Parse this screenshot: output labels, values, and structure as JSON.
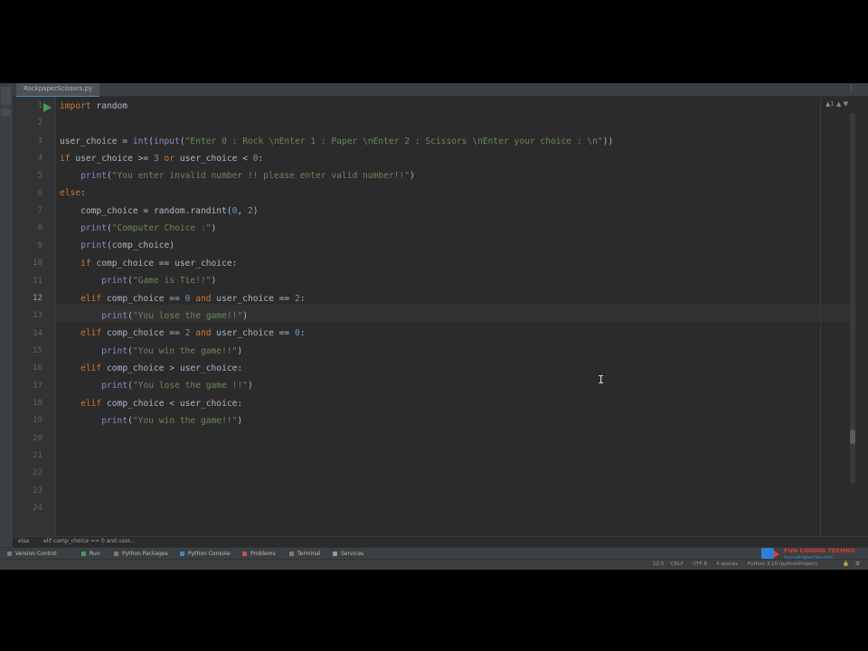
{
  "window": {
    "file_tab": "RockpaperScissors.py",
    "tab_more": "⋮",
    "warnings": "▲1 ▲ ▼"
  },
  "editor": {
    "line_numbers": [
      "1",
      "2",
      "3",
      "4",
      "5",
      "6",
      "7",
      "8",
      "9",
      "10",
      "11",
      "12",
      "13",
      "14",
      "15",
      "16",
      "17",
      "18",
      "19",
      "20",
      "21",
      "22",
      "23",
      "24"
    ],
    "current_line": 12,
    "cursor_glyph": "I"
  },
  "breadcrumb": {
    "scope": "else",
    "path": "elif comp_choice == 0 and user..."
  },
  "toolwindows": [
    {
      "label": "Version Control",
      "icon_color": "#7a7a7a"
    },
    {
      "label": "Run",
      "icon_color": "#499c54"
    },
    {
      "label": "Python Packages",
      "icon_color": "#7a7a7a"
    },
    {
      "label": "Python Console",
      "icon_color": "#3592c4"
    },
    {
      "label": "Problems",
      "icon_color": "#c75450"
    },
    {
      "label": "Terminal",
      "icon_color": "#7a7a7a"
    },
    {
      "label": "Services",
      "icon_color": "#9a9a9a"
    }
  ],
  "statusbar": {
    "position": "12:5",
    "line_sep": "CRLF",
    "encoding": "UTF-8",
    "indent": "4 spaces",
    "interpreter": "Python 3.10 (pythonProject)"
  },
  "logo": {
    "name": "FUN CODING TECHNO",
    "tagline": "funcodingtechno.com"
  },
  "colors": {
    "keyword": "#cc7832",
    "string": "#6a8759",
    "number": "#6897bb",
    "builtin": "#8888c6",
    "text": "#a9b7c6"
  }
}
